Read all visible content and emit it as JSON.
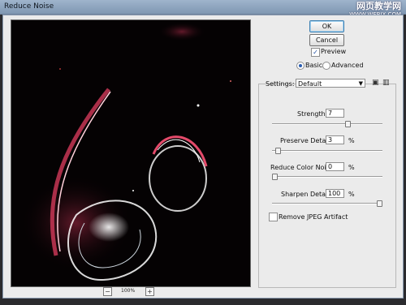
{
  "window": {
    "title": "Reduce Noise"
  },
  "watermark": {
    "line1": "网页教学网",
    "line2": "WWW.WEBJX.COM"
  },
  "buttons": {
    "ok": "OK",
    "cancel": "Cancel"
  },
  "preview": {
    "label": "Preview",
    "checked": true
  },
  "mode": {
    "basic": "Basic",
    "advanced": "Advanced",
    "selected": "Basic"
  },
  "settings": {
    "label": "Settings:",
    "value": "Default",
    "save_icon": "save-disk-icon",
    "delete_icon": "trash-icon"
  },
  "controls": {
    "strength": {
      "label": "Strength:",
      "value": "7",
      "unit": "",
      "slider_fraction": 0.7
    },
    "preserve": {
      "label": "Preserve Details:",
      "value": "3",
      "unit": "%",
      "slider_fraction": 0.03
    },
    "color_noise": {
      "label": "Reduce Color Noise:",
      "value": "0",
      "unit": "%",
      "slider_fraction": 0.0
    },
    "sharpen": {
      "label": "Sharpen Details:",
      "value": "100",
      "unit": "%",
      "slider_fraction": 1.0
    }
  },
  "jpeg": {
    "label": "Remove JPEG Artifact",
    "checked": false
  },
  "zoom": {
    "minus": "−",
    "plus": "+",
    "level": "100%"
  },
  "colors": {
    "accent": "#2a5db0",
    "preview_bg": "#000000",
    "streak": "#c0304a"
  }
}
